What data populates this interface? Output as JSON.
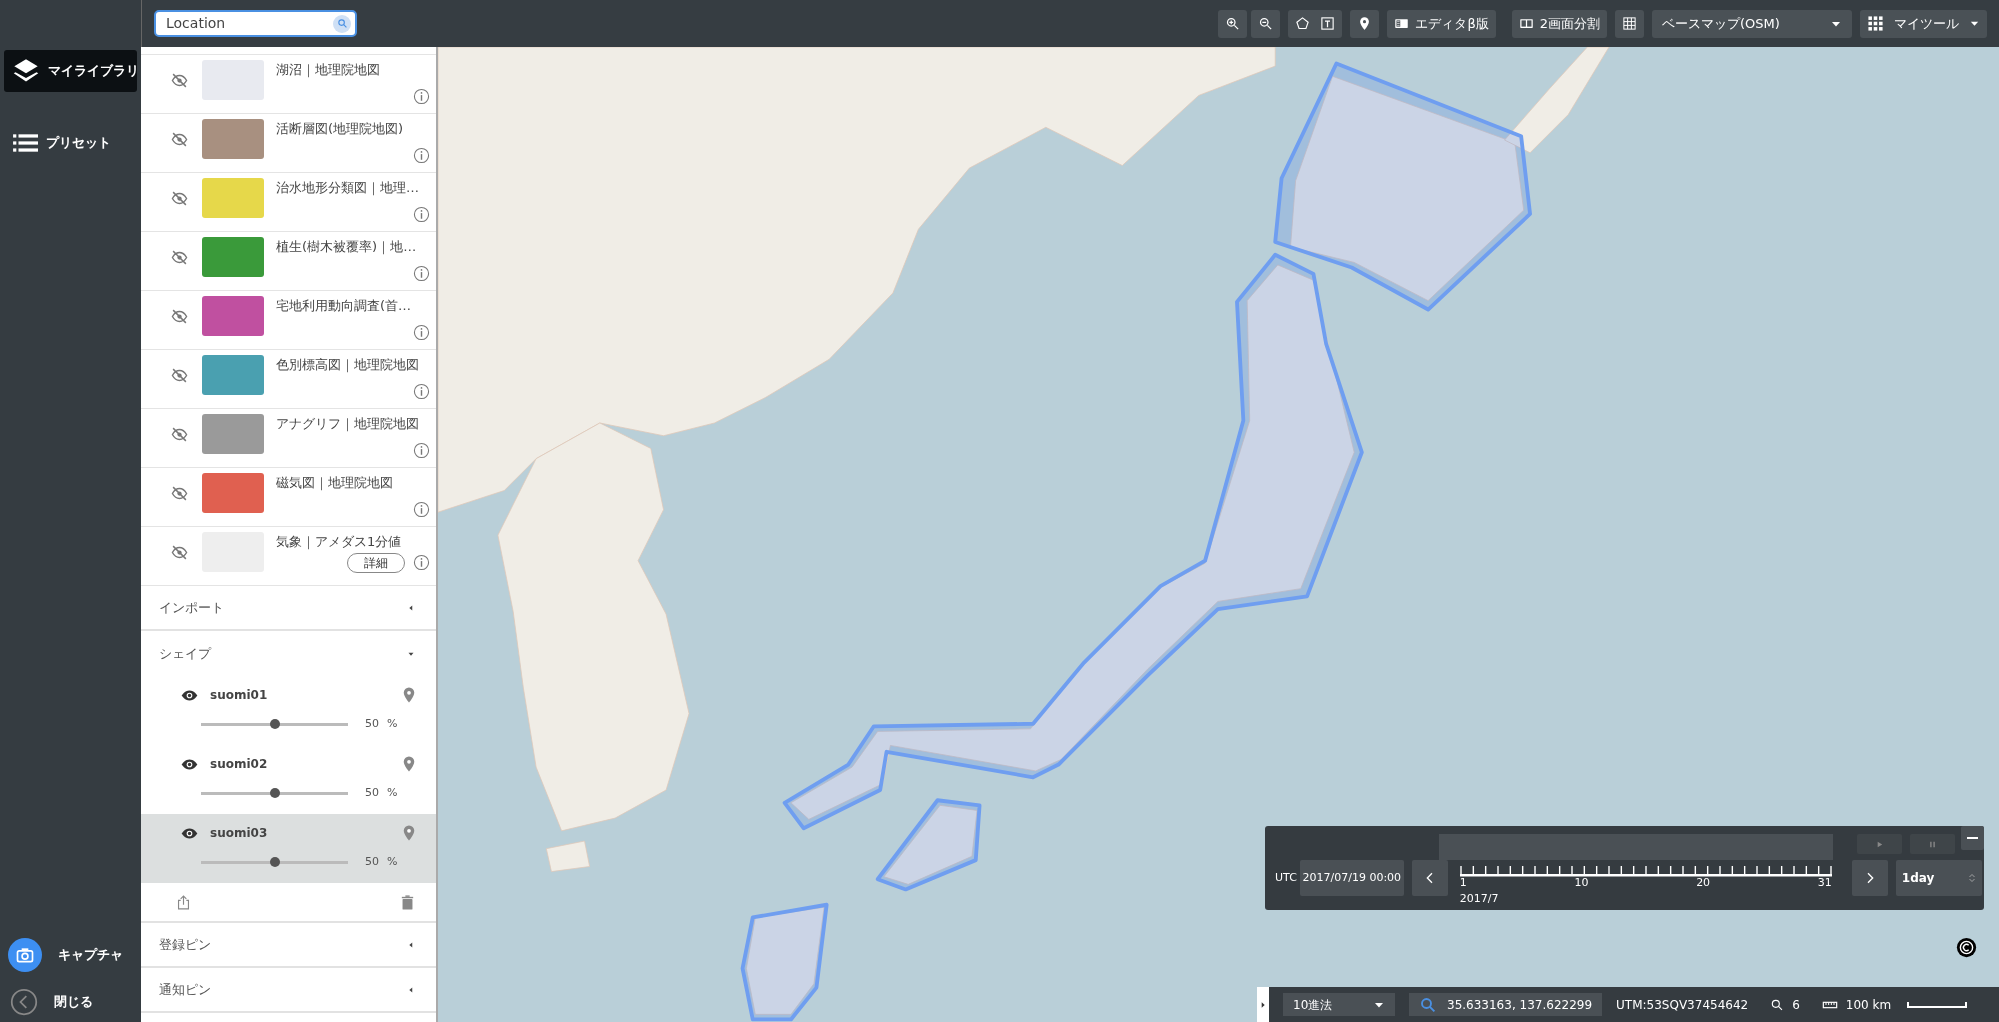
{
  "search": {
    "placeholder": "Location"
  },
  "toolbar": {
    "editor": "エディタβ版",
    "split": "2画面分割",
    "basemap": "ベースマップ(OSM)",
    "mytools": "マイツール"
  },
  "nav": [
    {
      "label": "マイライブラリ",
      "selected": true
    },
    {
      "label": "プリセット",
      "selected": false
    }
  ],
  "nav_bottom": {
    "capture": "キャプチャ",
    "close": "閉じる"
  },
  "layers": [
    {
      "title": "湖沼｜地理院地図",
      "visible": false
    },
    {
      "title": "活断層図(地理院地図)",
      "visible": false
    },
    {
      "title": "治水地形分類図｜地理…",
      "visible": false
    },
    {
      "title": "植生(樹木被覆率)｜地…",
      "visible": false
    },
    {
      "title": "宅地利用動向調査(首…",
      "visible": false
    },
    {
      "title": "色別標高図｜地理院地図",
      "visible": false
    },
    {
      "title": "アナグリフ｜地理院地図",
      "visible": false
    },
    {
      "title": "磁気図｜地理院地図",
      "visible": false
    },
    {
      "title": "気象｜アメダス1分値",
      "visible": false,
      "detail": "詳細"
    }
  ],
  "sections": [
    {
      "title": "インポート",
      "expanded": false
    },
    {
      "title": "シェイプ",
      "expanded": true,
      "shapes": [
        {
          "name": "suomi01",
          "visible": true,
          "selected": false,
          "level": 0.5,
          "reading": "50",
          "unit": "%"
        },
        {
          "name": "suomi02",
          "visible": true,
          "selected": false,
          "level": 0.5,
          "reading": "50",
          "unit": "%"
        },
        {
          "name": "suomi03",
          "visible": true,
          "selected": true,
          "level": 0.5,
          "reading": "50",
          "unit": "%"
        }
      ]
    },
    {
      "title": "登録ピン",
      "expanded": false
    },
    {
      "title": "通知ピン",
      "expanded": false
    }
  ],
  "timeline": {
    "timezone": "UTC",
    "datetime": "2017/07/19 00:00",
    "ticks": [
      "1",
      "10",
      "20",
      "31"
    ],
    "month": "2017/7",
    "step": "1day"
  },
  "status_bar": {
    "format": "10進法",
    "coords": "35.633163, 137.622299",
    "utm": "UTM:53SQV37454642",
    "zoom": "6",
    "scale": "100 km"
  }
}
